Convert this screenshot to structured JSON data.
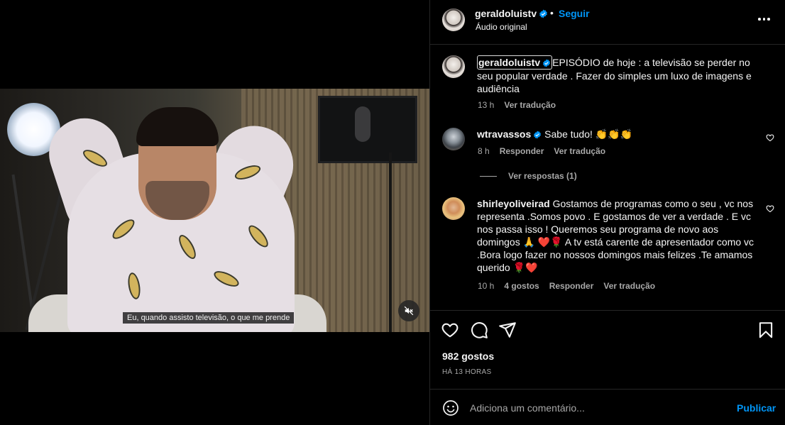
{
  "post": {
    "username": "geraldoluistv",
    "verified": true,
    "follow_label": "Seguir",
    "audio_label": "Áudio original",
    "subtitle": "Eu, quando assisto televisão, o que me prende"
  },
  "caption": {
    "username": "geraldoluistv",
    "text": "EPISÓDIO de hoje : a televisão se perder no seu popular verdade . Fazer do simples um luxo de imagens e audiência",
    "time": "13 h",
    "translate": "Ver tradução"
  },
  "comments": [
    {
      "username": "wtravassos",
      "verified": true,
      "text": "Sabe tudo! 👏👏👏",
      "time": "8 h",
      "reply": "Responder",
      "translate": "Ver tradução",
      "view_replies": "Ver respostas (1)"
    },
    {
      "username": "shirleyoliveirad",
      "verified": false,
      "text": "Gostamos de programas como o seu , vc nos representa .Somos povo . E gostamos de ver a verdade . E vc nos passa isso ! Queremos seu programa de novo aos domingos 🙏 ❤️🌹 A tv está carente de apresentador como vc .Bora logo fazer no nossos domingos mais felizes .Te amamos querido 🌹❤️",
      "time": "10 h",
      "likes": "4 gostos",
      "reply": "Responder",
      "translate": "Ver tradução"
    }
  ],
  "actions": {
    "icons": [
      "heart-icon",
      "comment-icon",
      "share-icon",
      "bookmark-icon"
    ],
    "likes_label": "982 gostos",
    "time_ago": "HÁ 13 HORAS"
  },
  "add_comment": {
    "placeholder": "Adiciona um comentário...",
    "post_label": "Publicar"
  },
  "colors": {
    "background": "#000000",
    "accent": "#0095f6",
    "secondary_text": "#a8a8a8",
    "divider": "#262626"
  }
}
